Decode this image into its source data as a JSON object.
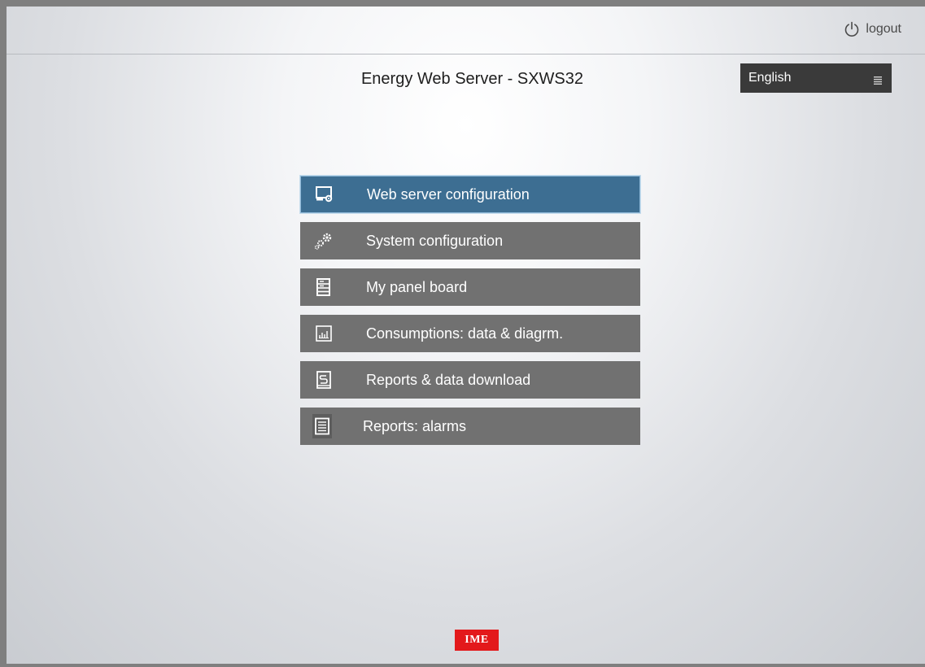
{
  "header": {
    "logout_label": "logout",
    "logout_icon": "power-icon"
  },
  "title": "Energy Web Server - SXWS32",
  "language": {
    "selected": "English",
    "icon": "menu-icon"
  },
  "menu": {
    "items": [
      {
        "label": "Web server configuration",
        "icon": "monitor-gear-icon",
        "active": true
      },
      {
        "label": "System configuration",
        "icon": "gears-icon",
        "active": false
      },
      {
        "label": "My panel board",
        "icon": "panel-board-icon",
        "active": false
      },
      {
        "label": "Consumptions: data & diagrm.",
        "icon": "bar-chart-icon",
        "active": false
      },
      {
        "label": "Reports & data download",
        "icon": "download-report-icon",
        "active": false
      },
      {
        "label": "Reports: alarms",
        "icon": "alarm-report-icon",
        "active": false
      }
    ]
  },
  "footer": {
    "logo_text": "IME"
  },
  "colors": {
    "active_item": "#3d6e92",
    "item": "#717171",
    "logo": "#e3191b"
  }
}
